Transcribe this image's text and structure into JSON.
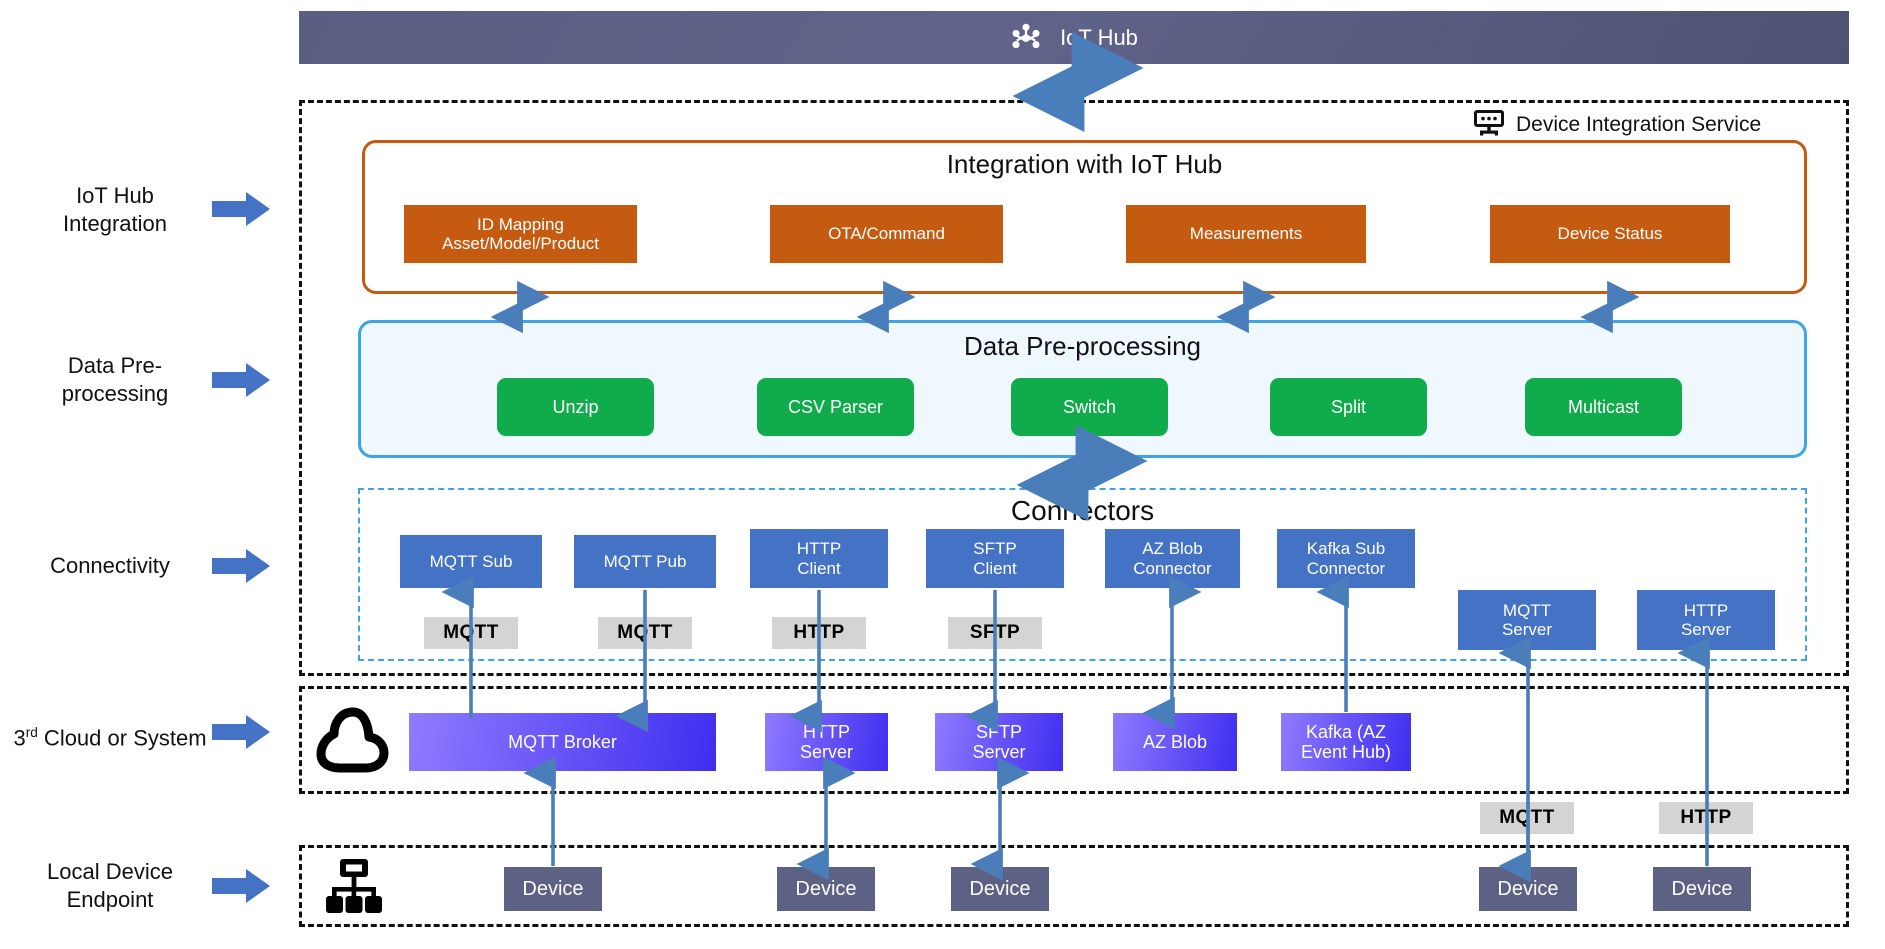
{
  "header": {
    "title": "IoT Hub",
    "icon": "hub-nodes-icon",
    "bar_color": "#5b5e83"
  },
  "service_box": {
    "label": "Device Integration Service",
    "icon": "server-device-icon"
  },
  "rail": {
    "items": [
      {
        "label": "IoT Hub Integration",
        "icon": "right-arrow-icon"
      },
      {
        "label": "Data Pre-processing",
        "icon": "right-arrow-icon"
      },
      {
        "label": "Connectivity",
        "icon": "right-arrow-icon"
      },
      {
        "label": "3rd Cloud or System",
        "label_prefix": "3",
        "label_sup": "rd",
        "label_rest": " Cloud or System",
        "icon": "right-arrow-icon"
      },
      {
        "label": "Local Device Endpoint",
        "icon": "right-arrow-icon"
      }
    ]
  },
  "integration": {
    "title": "Integration with IoT Hub",
    "color": "#c55a11",
    "boxes": [
      {
        "label": "ID Mapping\nAsset/Model/Product",
        "line1": "ID Mapping",
        "line2": "Asset/Model/Product"
      },
      {
        "label": "OTA/Command",
        "line1": "OTA/Command",
        "line2": ""
      },
      {
        "label": "Measurements",
        "line1": "Measurements",
        "line2": ""
      },
      {
        "label": "Device Status",
        "line1": "Device Status",
        "line2": ""
      }
    ]
  },
  "preprocessing": {
    "title": "Data Pre-processing",
    "color": "#10ac4c",
    "panel_color": "#eff8fe",
    "boxes": [
      {
        "label": "Unzip"
      },
      {
        "label": "CSV Parser"
      },
      {
        "label": "Switch"
      },
      {
        "label": "Split"
      },
      {
        "label": "Multicast"
      }
    ]
  },
  "connectors": {
    "title": "Connectors",
    "color": "#4472c4",
    "boxes": [
      {
        "line1": "MQTT Sub",
        "line2": ""
      },
      {
        "line1": "MQTT Pub",
        "line2": ""
      },
      {
        "line1": "HTTP",
        "line2": "Client"
      },
      {
        "line1": "SFTP",
        "line2": "Client"
      },
      {
        "line1": "AZ Blob",
        "line2": "Connector"
      },
      {
        "line1": "Kafka Sub",
        "line2": "Connector"
      },
      {
        "line1": "MQTT",
        "line2": "Server"
      },
      {
        "line1": "HTTP",
        "line2": "Server"
      }
    ]
  },
  "protocol_chips": [
    {
      "label": "MQTT"
    },
    {
      "label": "MQTT"
    },
    {
      "label": "HTTP"
    },
    {
      "label": "SFTP"
    },
    {
      "label": "MQTT"
    },
    {
      "label": "HTTP"
    }
  ],
  "cloud": {
    "icon": "cloud-icon",
    "boxes": [
      {
        "line1": "MQTT Broker",
        "line2": ""
      },
      {
        "line1": "HTTP",
        "line2": "Server"
      },
      {
        "line1": "SFTP",
        "line2": "Server"
      },
      {
        "line1": "AZ Blob",
        "line2": ""
      },
      {
        "line1": "Kafka (AZ",
        "line2": "Event Hub)"
      }
    ]
  },
  "local_devices": {
    "icon": "sitemap-device-icon",
    "boxes": [
      {
        "label": "Device"
      },
      {
        "label": "Device"
      },
      {
        "label": "Device"
      },
      {
        "label": "Device"
      },
      {
        "label": "Device"
      }
    ]
  }
}
